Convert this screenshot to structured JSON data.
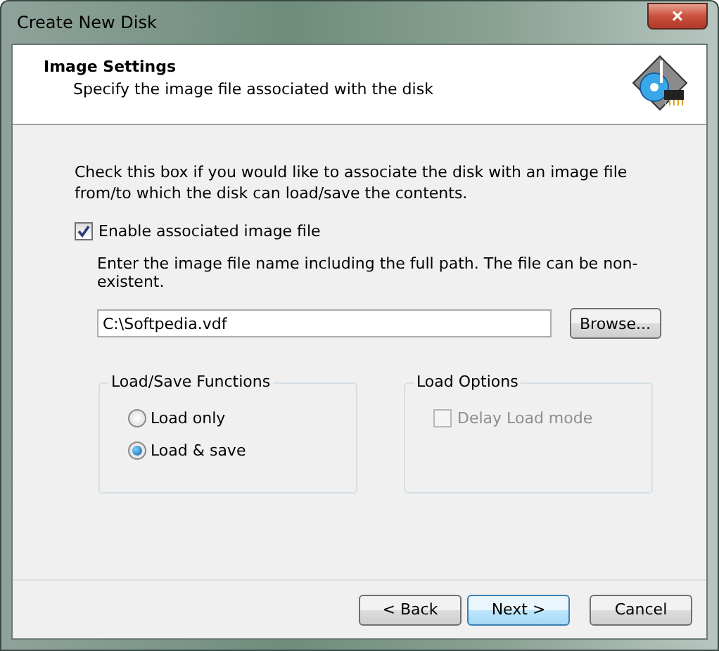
{
  "window": {
    "title": "Create New Disk",
    "close": "×"
  },
  "header": {
    "title": "Image Settings",
    "subtitle": "Specify the image file associated with the disk"
  },
  "intro": "Check this box if you would like to associate the disk with an image file from/to which the disk can load/save the contents.",
  "associate_checkbox": {
    "label": "Enable associated image file",
    "checked": true
  },
  "path_hint": "Enter the image file name including the full path. The file can be non-existent.",
  "path_field": {
    "value": "C:\\Softpedia.vdf"
  },
  "browse_button": "Browse...",
  "load_save_group": {
    "title": "Load/Save Functions",
    "options": [
      {
        "label": "Load only",
        "selected": false
      },
      {
        "label": "Load & save",
        "selected": true
      }
    ]
  },
  "load_options_group": {
    "title": "Load Options",
    "delay_load": {
      "label": "Delay Load mode",
      "checked": false,
      "disabled": true
    }
  },
  "buttons": [
    {
      "label": "< Back",
      "default": false
    },
    {
      "label": "Next >",
      "default": true
    },
    {
      "label": "Cancel",
      "default": false
    }
  ]
}
